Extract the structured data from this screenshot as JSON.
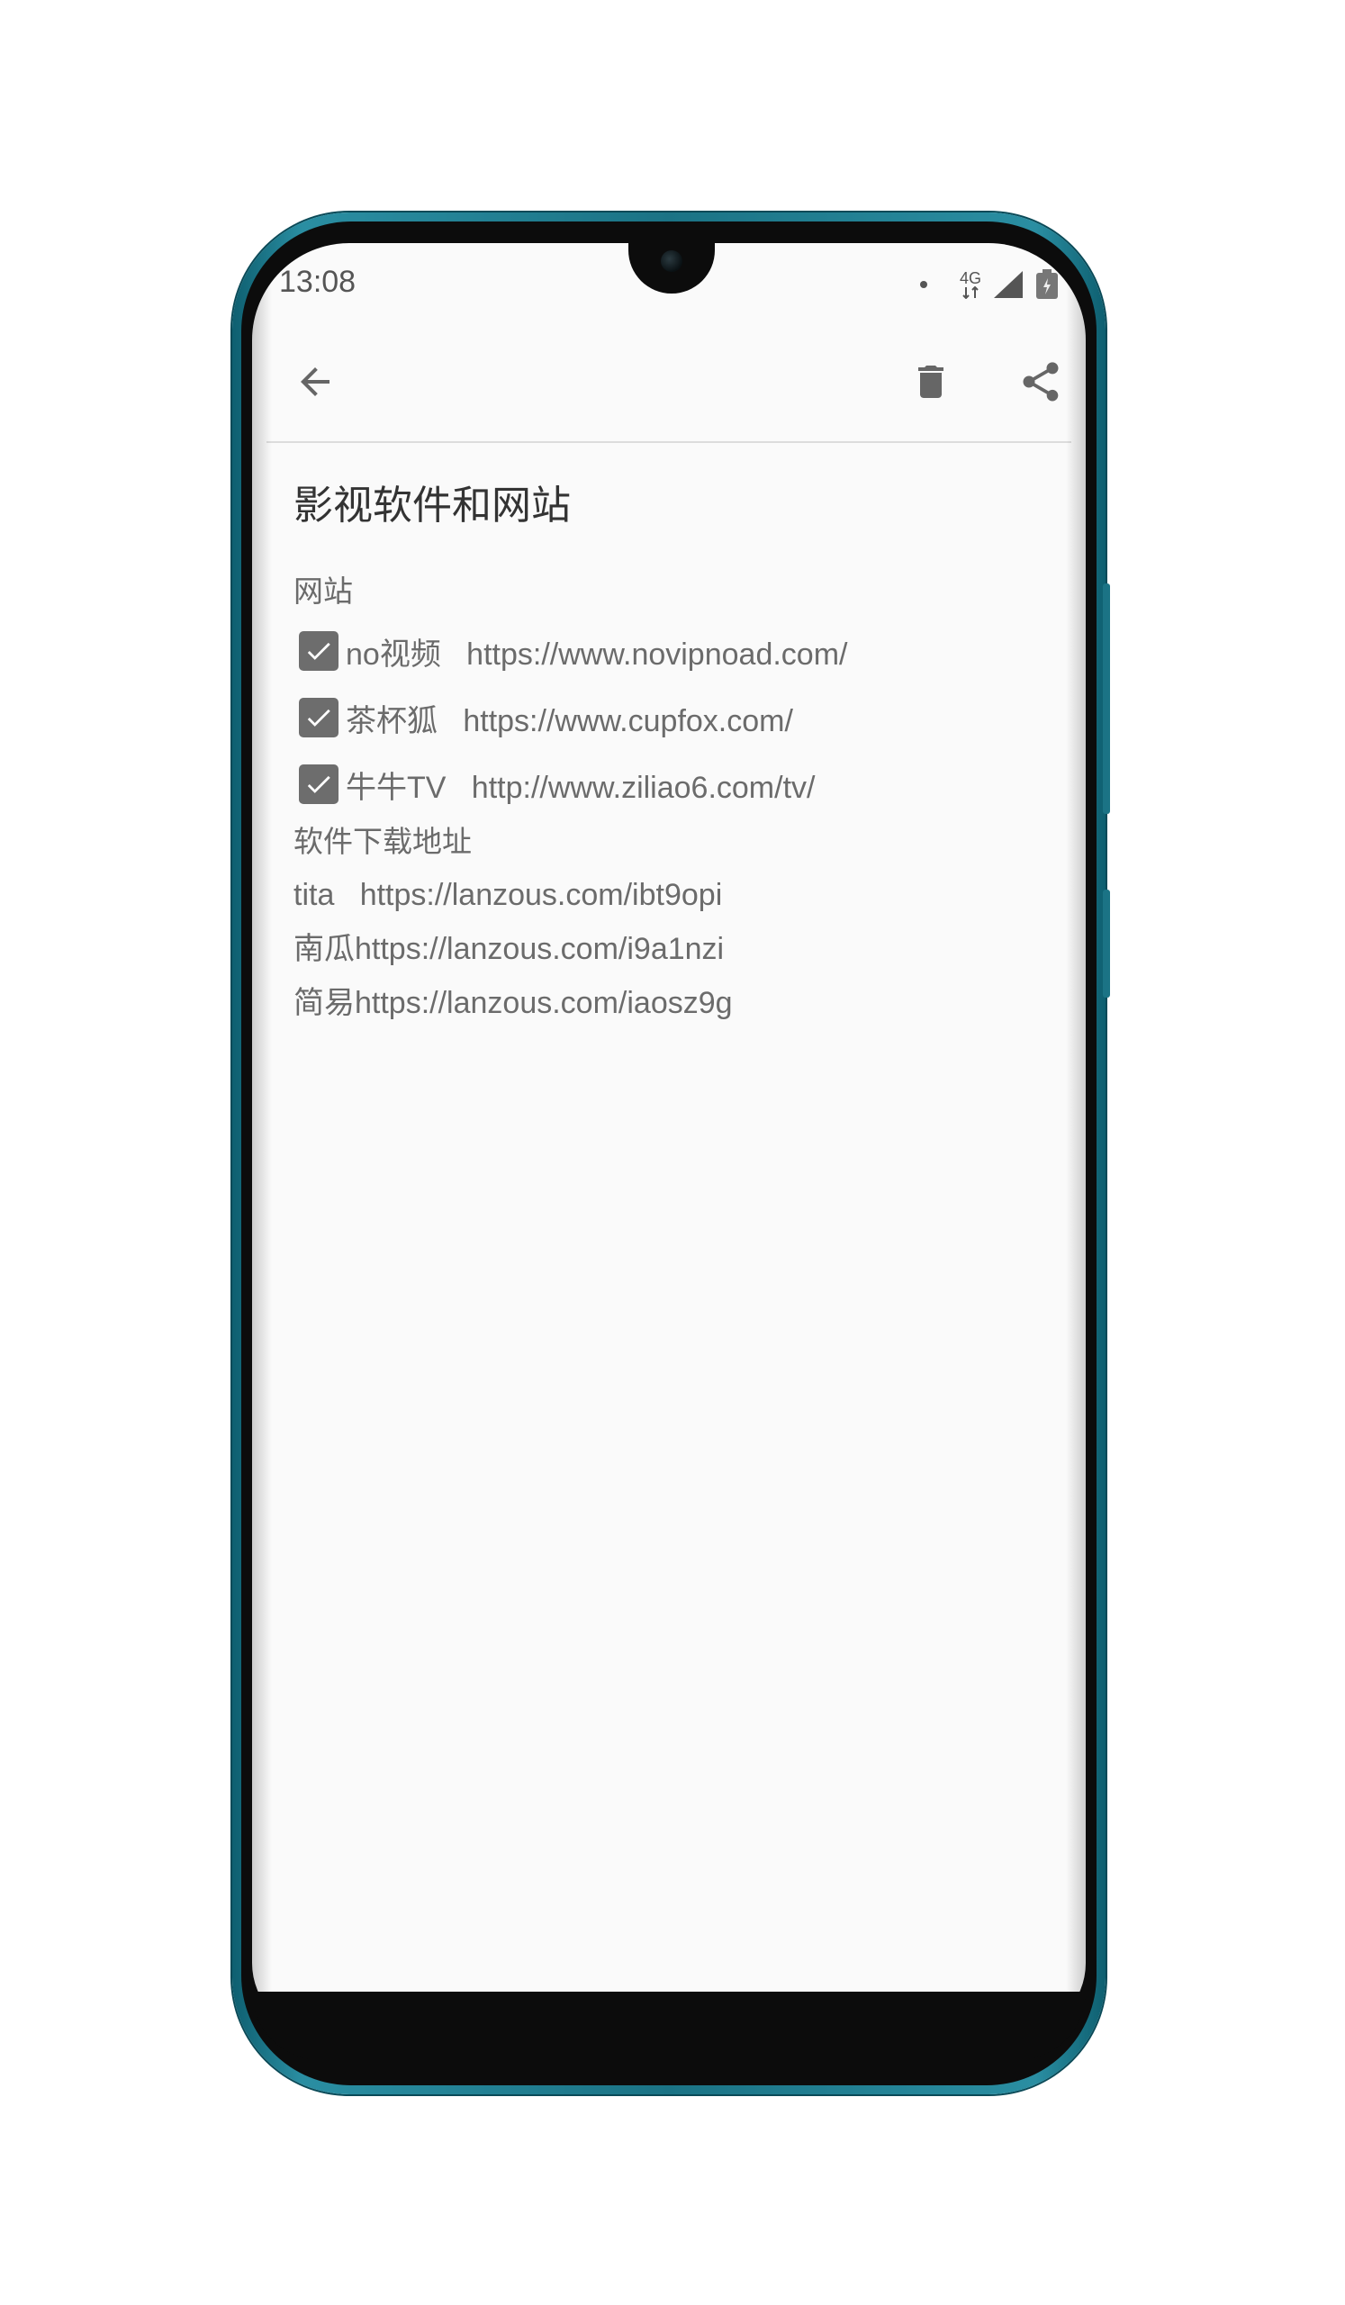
{
  "status_bar": {
    "time": "13:08",
    "network_label": "4G",
    "signal_icon": "signal-icon",
    "battery_icon": "battery-icon"
  },
  "toolbar": {
    "back_icon": "arrow-back-icon",
    "delete_icon": "trash-icon",
    "share_icon": "share-icon"
  },
  "note": {
    "title": "影视软件和网站",
    "sections": [
      {
        "heading": "网站",
        "items": [
          {
            "checked": true,
            "text": "no视频   https://www.novipnoad.com/"
          },
          {
            "checked": true,
            "text": "茶杯狐   https://www.cupfox.com/"
          },
          {
            "checked": true,
            "text": "牛牛TV   http://www.ziliao6.com/tv/"
          }
        ]
      },
      {
        "heading": "软件下载地址",
        "lines": [
          "tita   https://lanzous.com/ibt9opi",
          "南瓜https://lanzous.com/i9a1nzi",
          "简易https://lanzous.com/iaosz9g"
        ]
      }
    ]
  },
  "colors": {
    "frame_accent": "#1b7385",
    "screen_background": "#fafafa",
    "text_primary": "#333333",
    "text_secondary": "#6b6b6b",
    "checkbox_fill": "#6d6d6d"
  }
}
